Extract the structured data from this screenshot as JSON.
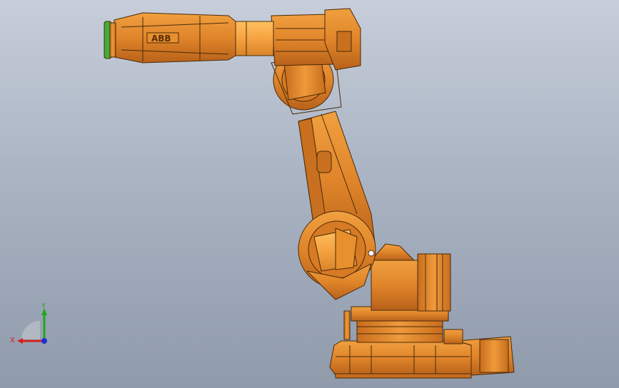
{
  "viewport": {
    "background_top": "#c7ceda",
    "background_bottom": "#8f9aab"
  },
  "model": {
    "name": "robot-arm",
    "brand_text": "ABB",
    "body_color": "#e0852a",
    "edge_color": "#4a2a08",
    "tool_ring_color": "#3fae3a"
  },
  "triad": {
    "x_label": "X",
    "y_label": "Y",
    "x_color": "#d42020",
    "y_color": "#1fa81f",
    "z_color": "#2030d0"
  }
}
